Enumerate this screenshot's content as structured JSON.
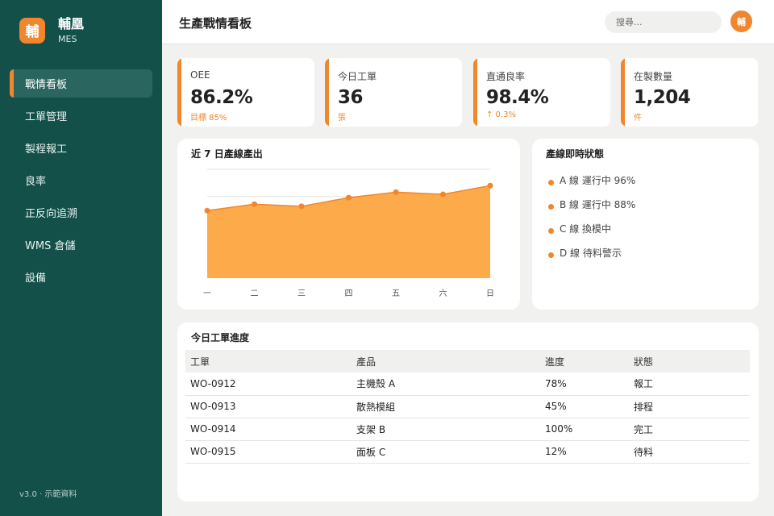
{
  "brand": {
    "logo": "輔",
    "name": "輔凰",
    "sub": "MES"
  },
  "sidebar": {
    "items": [
      {
        "label": "戰情看板",
        "active": true
      },
      {
        "label": "工單管理"
      },
      {
        "label": "製程報工"
      },
      {
        "label": "良率"
      },
      {
        "label": "正反向追溯"
      },
      {
        "label": "WMS 倉儲"
      },
      {
        "label": "設備"
      }
    ],
    "version": "v3.0 · 示範資料"
  },
  "header": {
    "title": "生產戰情看板",
    "search_placeholder": "搜尋...",
    "avatar": "輔"
  },
  "kpis": [
    {
      "label": "OEE",
      "value": "86.2%",
      "sub": "目標 85%"
    },
    {
      "label": "今日工單",
      "value": "36",
      "sub": "張"
    },
    {
      "label": "直通良率",
      "value": "98.4%",
      "sub": "↑ 0.3%"
    },
    {
      "label": "在製數量",
      "value": "1,204",
      "sub": "件"
    }
  ],
  "output_panel": {
    "title": "近 7 日產線產出"
  },
  "chart_data": {
    "type": "area",
    "categories": [
      "一",
      "二",
      "三",
      "四",
      "五",
      "六",
      "日"
    ],
    "values": [
      0.62,
      0.68,
      0.66,
      0.74,
      0.79,
      0.77,
      0.85
    ],
    "ylim": [
      0,
      1
    ],
    "grid": true,
    "colors": {
      "fill": "#fdaa4b",
      "line": "#f2862c",
      "grid": "#e3e5e1"
    }
  },
  "status_panel": {
    "title": "產線即時狀態",
    "items": [
      "A 線 運行中 96%",
      "B 線 運行中 88%",
      "C 線 換模中",
      "D 線 待料警示"
    ]
  },
  "orders_panel": {
    "title": "今日工單進度",
    "columns": [
      "工單",
      "產品",
      "進度",
      "狀態"
    ],
    "rows": [
      [
        "WO-0912",
        "主機殼 A",
        "78%",
        "報工"
      ],
      [
        "WO-0913",
        "散熱模組",
        "45%",
        "排程"
      ],
      [
        "WO-0914",
        "支架 B",
        "100%",
        "完工"
      ],
      [
        "WO-0915",
        "面板 C",
        "12%",
        "待料"
      ]
    ]
  },
  "colors": {
    "sidebar": "#13504a",
    "accent": "#f2862c",
    "background": "#f1f2ef"
  }
}
